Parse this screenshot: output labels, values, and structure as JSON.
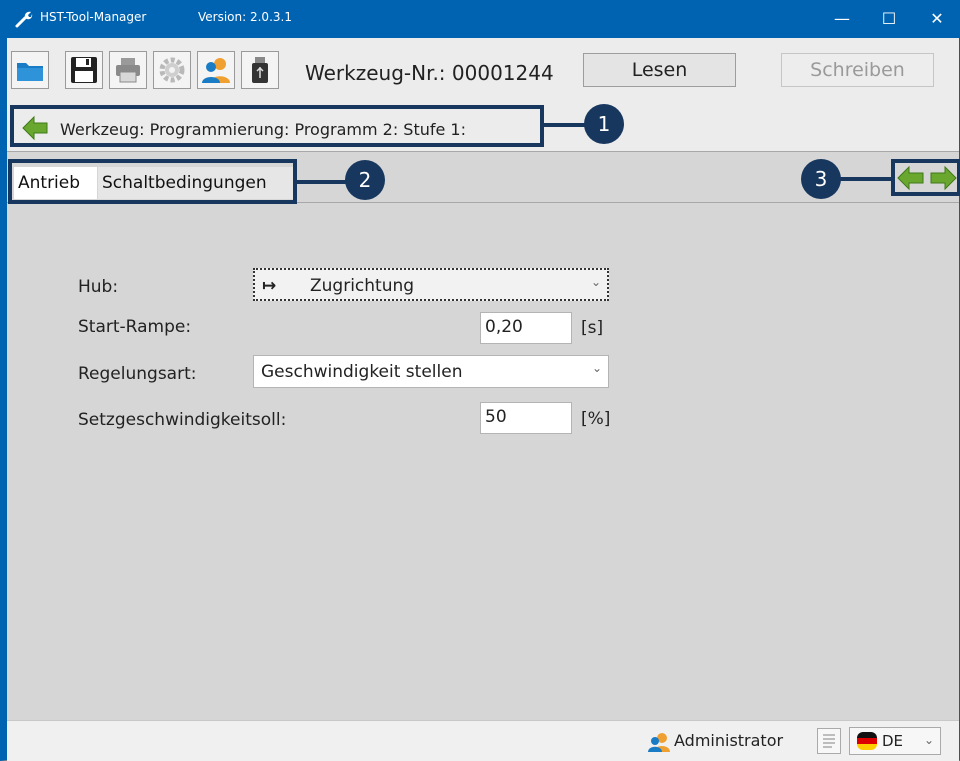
{
  "window": {
    "title": "HST-Tool-Manager",
    "version": "Version: 2.0.3.1",
    "minimize": "—",
    "maximize": "☐",
    "close": "✕"
  },
  "toolbar": {
    "icons": [
      "folder-icon",
      "save-icon",
      "printer-icon",
      "settings-gear-icon",
      "users-icon",
      "usb-stick-icon"
    ],
    "tool_number": "Werkzeug-Nr.: 00001244",
    "read_label": "Lesen",
    "write_label": "Schreiben",
    "write_enabled": false
  },
  "breadcrumb": {
    "text": "Werkzeug: Programmierung: Programm 2: Stufe 1:"
  },
  "tabs": [
    {
      "label": "Antrieb",
      "active": true
    },
    {
      "label": "Schaltbedingungen",
      "active": false
    }
  ],
  "callouts": [
    "1",
    "2",
    "3"
  ],
  "form": {
    "hub": {
      "label": "Hub:",
      "value": "Zugrichtung",
      "arrow": "↦"
    },
    "start_rampe": {
      "label": "Start-Rampe:",
      "value": "0,20",
      "unit": "[s]"
    },
    "regelungsart": {
      "label": "Regelungsart:",
      "value": "Geschwindigkeit stellen"
    },
    "setzgeschwindigkeit": {
      "label": "Setzgeschwindigkeitsoll:",
      "value": "50",
      "unit": "[%]"
    }
  },
  "statusbar": {
    "user": "Administrator",
    "language": "DE"
  },
  "colors": {
    "titlebar": "#0063b1",
    "callout": "#17375e",
    "nav_green": "#6aa72f",
    "background": "#d6d6d6"
  }
}
